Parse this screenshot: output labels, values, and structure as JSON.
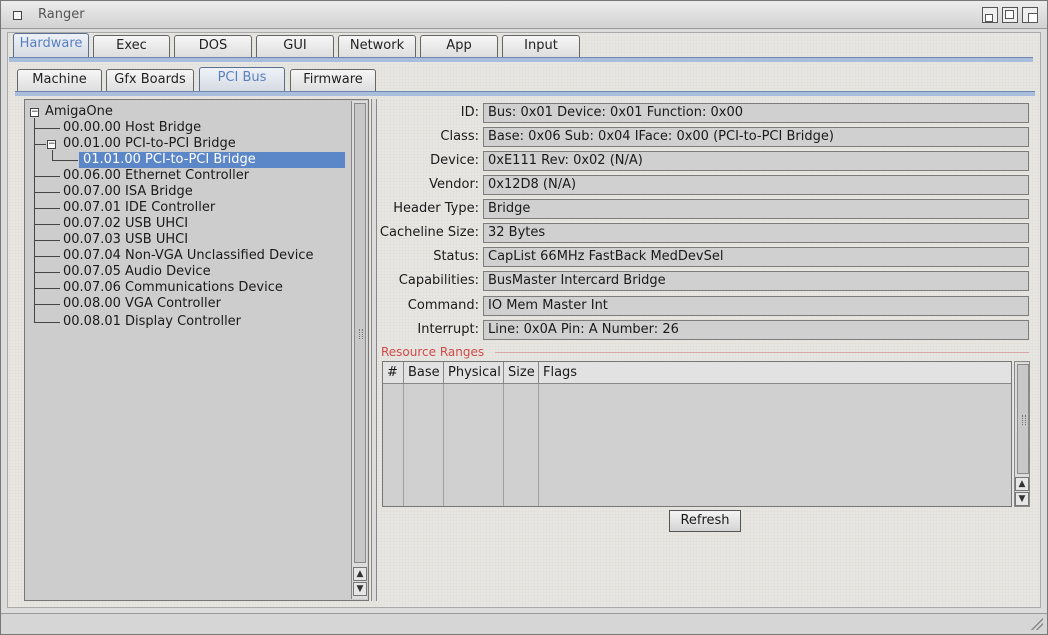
{
  "window": {
    "title": "Ranger"
  },
  "main_tabs": [
    {
      "label": "Hardware",
      "active": true
    },
    {
      "label": "Exec",
      "active": false
    },
    {
      "label": "DOS",
      "active": false
    },
    {
      "label": "GUI",
      "active": false
    },
    {
      "label": "Network",
      "active": false
    },
    {
      "label": "App",
      "active": false
    },
    {
      "label": "Input",
      "active": false
    }
  ],
  "sub_tabs": [
    {
      "label": "Machine",
      "active": false
    },
    {
      "label": "Gfx Boards",
      "active": false
    },
    {
      "label": "PCI Bus",
      "active": true
    },
    {
      "label": "Firmware",
      "active": false
    }
  ],
  "tree": {
    "root": "AmigaOne",
    "items": [
      {
        "label": "00.00.00 Host Bridge"
      },
      {
        "label": "00.01.00 PCI-to-PCI Bridge",
        "expanded": true
      },
      {
        "label": "01.01.00 PCI-to-PCI Bridge",
        "selected": true
      },
      {
        "label": "00.06.00 Ethernet Controller"
      },
      {
        "label": "00.07.00 ISA Bridge"
      },
      {
        "label": "00.07.01 IDE Controller"
      },
      {
        "label": "00.07.02 USB UHCI"
      },
      {
        "label": "00.07.03 USB UHCI"
      },
      {
        "label": "00.07.04 Non-VGA Unclassified Device"
      },
      {
        "label": "00.07.05 Audio Device"
      },
      {
        "label": "00.07.06 Communications Device"
      },
      {
        "label": "00.08.00 VGA Controller"
      },
      {
        "label": "00.08.01 Display Controller"
      }
    ]
  },
  "details": [
    {
      "label": "ID:",
      "value": "Bus: 0x01 Device: 0x01 Function: 0x00"
    },
    {
      "label": "Class:",
      "value": "Base: 0x06 Sub: 0x04 IFace: 0x00 (PCI-to-PCI Bridge)"
    },
    {
      "label": "Device:",
      "value": "0xE111 Rev: 0x02 (N/A)"
    },
    {
      "label": "Vendor:",
      "value": "0x12D8 (N/A)"
    },
    {
      "label": "Header Type:",
      "value": "Bridge"
    },
    {
      "label": "Cacheline Size:",
      "value": "32 Bytes"
    },
    {
      "label": "Status:",
      "value": "CapList 66MHz FastBack MedDevSel"
    },
    {
      "label": "Capabilities:",
      "value": "BusMaster Intercard Bridge"
    },
    {
      "label": "Command:",
      "value": "IO Mem Master Int"
    },
    {
      "label": "Interrupt:",
      "value": "Line: 0x0A Pin: A Number: 26"
    }
  ],
  "resources": {
    "group_label": "Resource Ranges",
    "columns": [
      "#",
      "Base",
      "Physical",
      "Size",
      "Flags"
    ]
  },
  "refresh_label": "Refresh",
  "colors": {
    "accent": "#5b87c9",
    "group_label": "#d04a4a"
  }
}
